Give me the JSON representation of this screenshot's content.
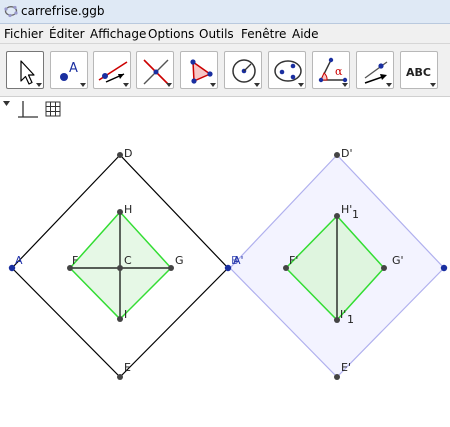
{
  "window": {
    "title": "carrefrise.ggb"
  },
  "menu": [
    "Fichier",
    "Éditer",
    "Affichage",
    "Options",
    "Outils",
    "Fenêtre",
    "Aide"
  ],
  "toolbar": {
    "text_tool_label": "ABC",
    "angle_glyph": "α",
    "tools": [
      "move-tool",
      "point-tool",
      "line-tool",
      "perpendicular-tool",
      "polygon-tool",
      "circle-tool",
      "conic-tool",
      "angle-tool",
      "transform-tool",
      "text-tool"
    ]
  },
  "points": {
    "D": "D",
    "A": "A",
    "E": "E",
    "B_cut": "B",
    "H": "H",
    "F": "F",
    "C": "C",
    "G": "G",
    "I": "I",
    "D_prime": "D'",
    "A_prime": "A'",
    "E_prime": "E'",
    "H1_prime": "H'",
    "H1_sub": "1",
    "F_prime": "F'",
    "G_prime": "G'",
    "I1_prime": "I'",
    "I1_sub": "1"
  }
}
